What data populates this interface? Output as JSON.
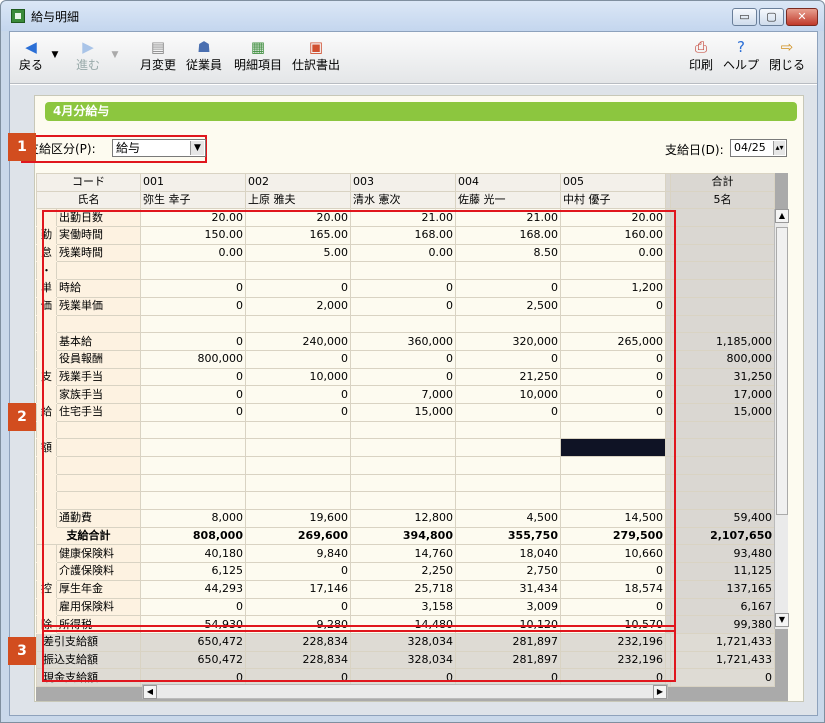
{
  "window": {
    "title": "給与明細",
    "min": "▭",
    "max": "▢",
    "close": "✕"
  },
  "toolbar": {
    "back": "戻る",
    "forward": "進む",
    "month_change": "月変更",
    "employee": "従業員",
    "detail_items": "明細項目",
    "journal": "仕訳書出",
    "print": "印刷",
    "help": "ヘルプ",
    "close": "閉じる"
  },
  "month_title": "4月分給与",
  "kubun": {
    "label": "支給区分(P):",
    "value": "給与"
  },
  "paydate": {
    "label": "支給日(D):",
    "value": "04/25"
  },
  "badges": {
    "b1": "1",
    "b2": "2",
    "b3": "3"
  },
  "grid": {
    "code_label": "コード",
    "name_label": "氏名",
    "total_label": "合計",
    "total_count": "5名",
    "employees": [
      {
        "code": "001",
        "name": "弥生 幸子"
      },
      {
        "code": "002",
        "name": "上原 雅夫"
      },
      {
        "code": "003",
        "name": "清水 憲次"
      },
      {
        "code": "004",
        "name": "佐藤 光一"
      },
      {
        "code": "005",
        "name": "中村 優子"
      }
    ],
    "sec_kintai": [
      "勤",
      "怠",
      "・",
      "単",
      "価"
    ],
    "sec_shikyu": [
      "支",
      "給",
      "額"
    ],
    "sec_kojo": [
      "控",
      "除"
    ],
    "rows": [
      {
        "label": "出勤日数",
        "v": [
          "20.00",
          "20.00",
          "21.00",
          "21.00",
          "20.00"
        ],
        "t": ""
      },
      {
        "label": "実働時間",
        "v": [
          "150.00",
          "165.00",
          "168.00",
          "168.00",
          "160.00"
        ],
        "t": ""
      },
      {
        "label": "残業時間",
        "v": [
          "0.00",
          "5.00",
          "0.00",
          "8.50",
          "0.00"
        ],
        "t": ""
      },
      {
        "label": "",
        "v": [
          "",
          "",
          "",
          "",
          ""
        ],
        "t": ""
      },
      {
        "label": "時給",
        "v": [
          "0",
          "0",
          "0",
          "0",
          "1,200"
        ],
        "t": ""
      },
      {
        "label": "残業単価",
        "v": [
          "0",
          "2,000",
          "0",
          "2,500",
          "0"
        ],
        "t": ""
      },
      {
        "label": "",
        "v": [
          "",
          "",
          "",
          "",
          ""
        ],
        "t": ""
      },
      {
        "label": "基本給",
        "v": [
          "0",
          "240,000",
          "360,000",
          "320,000",
          "265,000"
        ],
        "t": "1,185,000"
      },
      {
        "label": "役員報酬",
        "v": [
          "800,000",
          "0",
          "0",
          "0",
          "0"
        ],
        "t": "800,000"
      },
      {
        "label": "残業手当",
        "v": [
          "0",
          "10,000",
          "0",
          "21,250",
          "0"
        ],
        "t": "31,250"
      },
      {
        "label": "家族手当",
        "v": [
          "0",
          "0",
          "7,000",
          "10,000",
          "0"
        ],
        "t": "17,000"
      },
      {
        "label": "住宅手当",
        "v": [
          "0",
          "0",
          "15,000",
          "0",
          "0"
        ],
        "t": "15,000"
      },
      {
        "label": "",
        "v": [
          "",
          "",
          "",
          "",
          ""
        ],
        "t": ""
      },
      {
        "label": "",
        "v": [
          "",
          "",
          "",
          "",
          ""
        ],
        "t": ""
      },
      {
        "label": "",
        "v": [
          "",
          "",
          "",
          "",
          ""
        ],
        "t": ""
      },
      {
        "label": "",
        "v": [
          "",
          "",
          "",
          "",
          ""
        ],
        "t": ""
      },
      {
        "label": "",
        "v": [
          "",
          "",
          "",
          "",
          ""
        ],
        "t": ""
      },
      {
        "label": "通勤費",
        "v": [
          "8,000",
          "19,600",
          "12,800",
          "4,500",
          "14,500"
        ],
        "t": "59,400"
      },
      {
        "label": "支給合計",
        "v": [
          "808,000",
          "269,600",
          "394,800",
          "355,750",
          "279,500"
        ],
        "t": "2,107,650"
      },
      {
        "label": "健康保険料",
        "v": [
          "40,180",
          "9,840",
          "14,760",
          "18,040",
          "10,660"
        ],
        "t": "93,480"
      },
      {
        "label": "介護保険料",
        "v": [
          "6,125",
          "0",
          "2,250",
          "2,750",
          "0"
        ],
        "t": "11,125"
      },
      {
        "label": "厚生年金",
        "v": [
          "44,293",
          "17,146",
          "25,718",
          "31,434",
          "18,574"
        ],
        "t": "137,165"
      },
      {
        "label": "雇用保険料",
        "v": [
          "0",
          "0",
          "3,158",
          "3,009",
          "0"
        ],
        "t": "6,167"
      },
      {
        "label": "所得税",
        "v": [
          "54,930",
          "9,280",
          "14,480",
          "10,120",
          "10,570"
        ],
        "t": "99,380"
      },
      {
        "label": "差引支給額",
        "v": [
          "650,472",
          "228,834",
          "328,034",
          "281,897",
          "232,196"
        ],
        "t": "1,721,433"
      },
      {
        "label": "振込支給額",
        "v": [
          "650,472",
          "228,834",
          "328,034",
          "281,897",
          "232,196"
        ],
        "t": "1,721,433"
      },
      {
        "label": "現金支給額",
        "v": [
          "0",
          "0",
          "0",
          "0",
          "0"
        ],
        "t": "0"
      }
    ]
  }
}
